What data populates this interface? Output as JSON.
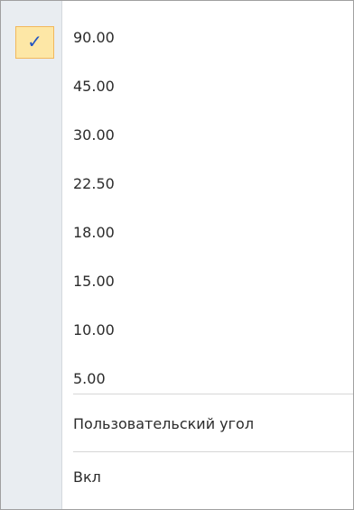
{
  "menu": {
    "items": [
      {
        "label": "90.00",
        "checked": true
      },
      {
        "label": "45.00"
      },
      {
        "label": "30.00"
      },
      {
        "label": "22.50"
      },
      {
        "label": "18.00"
      },
      {
        "label": "15.00"
      },
      {
        "label": "10.00"
      },
      {
        "label": "5.00"
      },
      {
        "label": "Пользовательский угол"
      },
      {
        "label": "Вкл"
      }
    ],
    "check_glyph": "✓",
    "colors": {
      "gutter": "#e9edf1",
      "check_bg": "#fde7a6",
      "check_border": "#f2b85c",
      "check_mark": "#2254c2"
    }
  }
}
